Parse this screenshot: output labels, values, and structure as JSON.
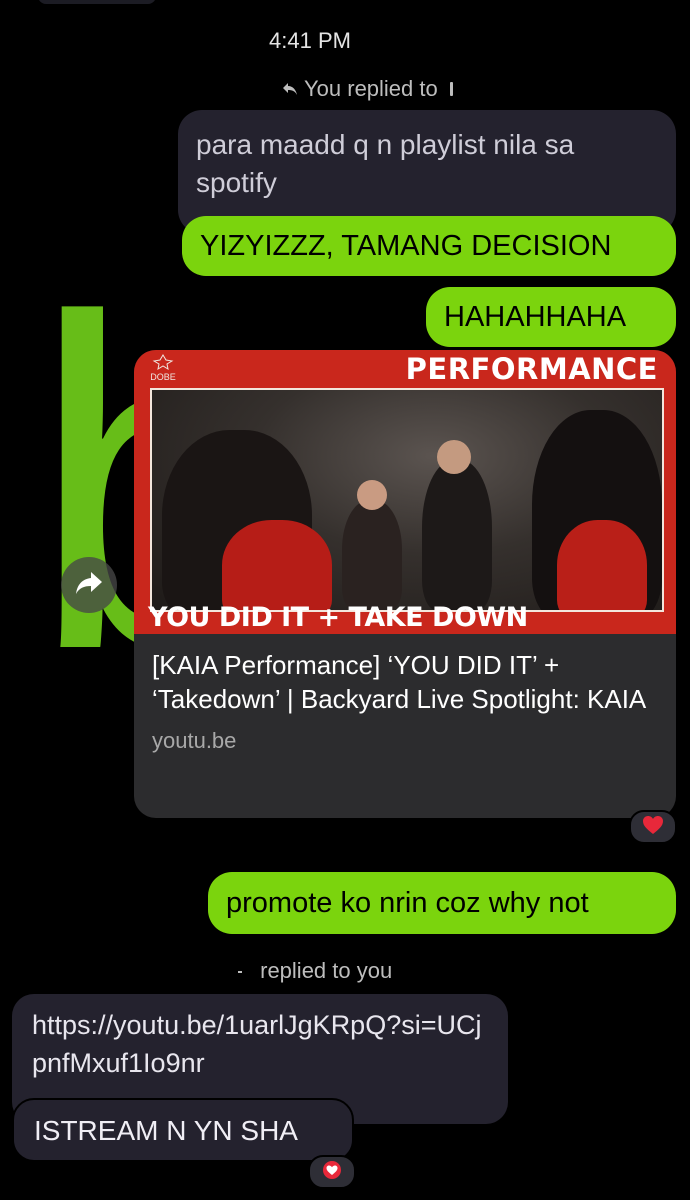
{
  "status": {
    "time": "4:41 PM"
  },
  "background": {
    "letter": "b"
  },
  "messages": {
    "reply_label_1": "You replied to",
    "quoted_text": "para maadd q n playlist nila sa spotify",
    "sent_1": "YIZYIZZZ, TAMANG DECISION",
    "sent_2": "HAHAHHAHA",
    "link_preview": {
      "thumb_logo": "DOBE",
      "thumb_top_text": "PERFORMANCE",
      "thumb_bottom_text": "YOU DID IT + TAKE DOWN",
      "title": "[KAIA Performance] ‘YOU DID IT’ + ‘Takedown’ | Backyard Live Spotlight: KAIA",
      "domain": "youtu.be"
    },
    "sent_3": "promote ko nrin coz why not",
    "reply_label_2": "replied to you",
    "received_link": "https://youtu.be/1uarlJgKRpQ?si=UCjpnfMxuf1Io9nr",
    "received_2": "ISTREAM N YN SHA"
  },
  "reactions": {
    "link_card_reaction": "heart",
    "received_reaction": "heart"
  },
  "colors": {
    "background": "#000000",
    "sent_bubble": "#7bd40d",
    "received_bubble": "#24222e",
    "link_card": "#2c2c2e",
    "thumb_red": "#c9271c",
    "heart": "#e8283a"
  }
}
